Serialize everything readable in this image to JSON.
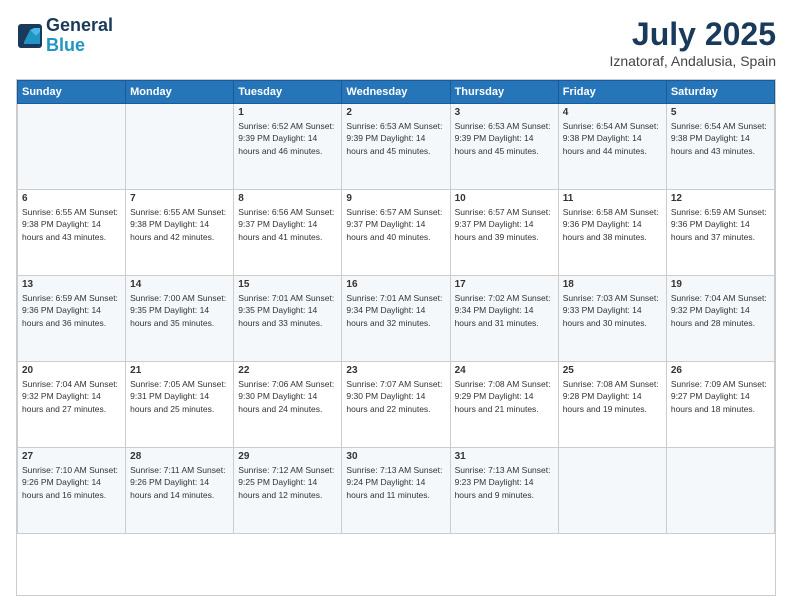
{
  "header": {
    "logo_line1": "General",
    "logo_line2": "Blue",
    "month": "July 2025",
    "location": "Iznatoraf, Andalusia, Spain"
  },
  "weekdays": [
    "Sunday",
    "Monday",
    "Tuesday",
    "Wednesday",
    "Thursday",
    "Friday",
    "Saturday"
  ],
  "weeks": [
    [
      {
        "day": "",
        "info": ""
      },
      {
        "day": "",
        "info": ""
      },
      {
        "day": "1",
        "info": "Sunrise: 6:52 AM\nSunset: 9:39 PM\nDaylight: 14 hours and 46 minutes."
      },
      {
        "day": "2",
        "info": "Sunrise: 6:53 AM\nSunset: 9:39 PM\nDaylight: 14 hours and 45 minutes."
      },
      {
        "day": "3",
        "info": "Sunrise: 6:53 AM\nSunset: 9:39 PM\nDaylight: 14 hours and 45 minutes."
      },
      {
        "day": "4",
        "info": "Sunrise: 6:54 AM\nSunset: 9:38 PM\nDaylight: 14 hours and 44 minutes."
      },
      {
        "day": "5",
        "info": "Sunrise: 6:54 AM\nSunset: 9:38 PM\nDaylight: 14 hours and 43 minutes."
      }
    ],
    [
      {
        "day": "6",
        "info": "Sunrise: 6:55 AM\nSunset: 9:38 PM\nDaylight: 14 hours and 43 minutes."
      },
      {
        "day": "7",
        "info": "Sunrise: 6:55 AM\nSunset: 9:38 PM\nDaylight: 14 hours and 42 minutes."
      },
      {
        "day": "8",
        "info": "Sunrise: 6:56 AM\nSunset: 9:37 PM\nDaylight: 14 hours and 41 minutes."
      },
      {
        "day": "9",
        "info": "Sunrise: 6:57 AM\nSunset: 9:37 PM\nDaylight: 14 hours and 40 minutes."
      },
      {
        "day": "10",
        "info": "Sunrise: 6:57 AM\nSunset: 9:37 PM\nDaylight: 14 hours and 39 minutes."
      },
      {
        "day": "11",
        "info": "Sunrise: 6:58 AM\nSunset: 9:36 PM\nDaylight: 14 hours and 38 minutes."
      },
      {
        "day": "12",
        "info": "Sunrise: 6:59 AM\nSunset: 9:36 PM\nDaylight: 14 hours and 37 minutes."
      }
    ],
    [
      {
        "day": "13",
        "info": "Sunrise: 6:59 AM\nSunset: 9:36 PM\nDaylight: 14 hours and 36 minutes."
      },
      {
        "day": "14",
        "info": "Sunrise: 7:00 AM\nSunset: 9:35 PM\nDaylight: 14 hours and 35 minutes."
      },
      {
        "day": "15",
        "info": "Sunrise: 7:01 AM\nSunset: 9:35 PM\nDaylight: 14 hours and 33 minutes."
      },
      {
        "day": "16",
        "info": "Sunrise: 7:01 AM\nSunset: 9:34 PM\nDaylight: 14 hours and 32 minutes."
      },
      {
        "day": "17",
        "info": "Sunrise: 7:02 AM\nSunset: 9:34 PM\nDaylight: 14 hours and 31 minutes."
      },
      {
        "day": "18",
        "info": "Sunrise: 7:03 AM\nSunset: 9:33 PM\nDaylight: 14 hours and 30 minutes."
      },
      {
        "day": "19",
        "info": "Sunrise: 7:04 AM\nSunset: 9:32 PM\nDaylight: 14 hours and 28 minutes."
      }
    ],
    [
      {
        "day": "20",
        "info": "Sunrise: 7:04 AM\nSunset: 9:32 PM\nDaylight: 14 hours and 27 minutes."
      },
      {
        "day": "21",
        "info": "Sunrise: 7:05 AM\nSunset: 9:31 PM\nDaylight: 14 hours and 25 minutes."
      },
      {
        "day": "22",
        "info": "Sunrise: 7:06 AM\nSunset: 9:30 PM\nDaylight: 14 hours and 24 minutes."
      },
      {
        "day": "23",
        "info": "Sunrise: 7:07 AM\nSunset: 9:30 PM\nDaylight: 14 hours and 22 minutes."
      },
      {
        "day": "24",
        "info": "Sunrise: 7:08 AM\nSunset: 9:29 PM\nDaylight: 14 hours and 21 minutes."
      },
      {
        "day": "25",
        "info": "Sunrise: 7:08 AM\nSunset: 9:28 PM\nDaylight: 14 hours and 19 minutes."
      },
      {
        "day": "26",
        "info": "Sunrise: 7:09 AM\nSunset: 9:27 PM\nDaylight: 14 hours and 18 minutes."
      }
    ],
    [
      {
        "day": "27",
        "info": "Sunrise: 7:10 AM\nSunset: 9:26 PM\nDaylight: 14 hours and 16 minutes."
      },
      {
        "day": "28",
        "info": "Sunrise: 7:11 AM\nSunset: 9:26 PM\nDaylight: 14 hours and 14 minutes."
      },
      {
        "day": "29",
        "info": "Sunrise: 7:12 AM\nSunset: 9:25 PM\nDaylight: 14 hours and 12 minutes."
      },
      {
        "day": "30",
        "info": "Sunrise: 7:13 AM\nSunset: 9:24 PM\nDaylight: 14 hours and 11 minutes."
      },
      {
        "day": "31",
        "info": "Sunrise: 7:13 AM\nSunset: 9:23 PM\nDaylight: 14 hours and 9 minutes."
      },
      {
        "day": "",
        "info": ""
      },
      {
        "day": "",
        "info": ""
      }
    ]
  ]
}
